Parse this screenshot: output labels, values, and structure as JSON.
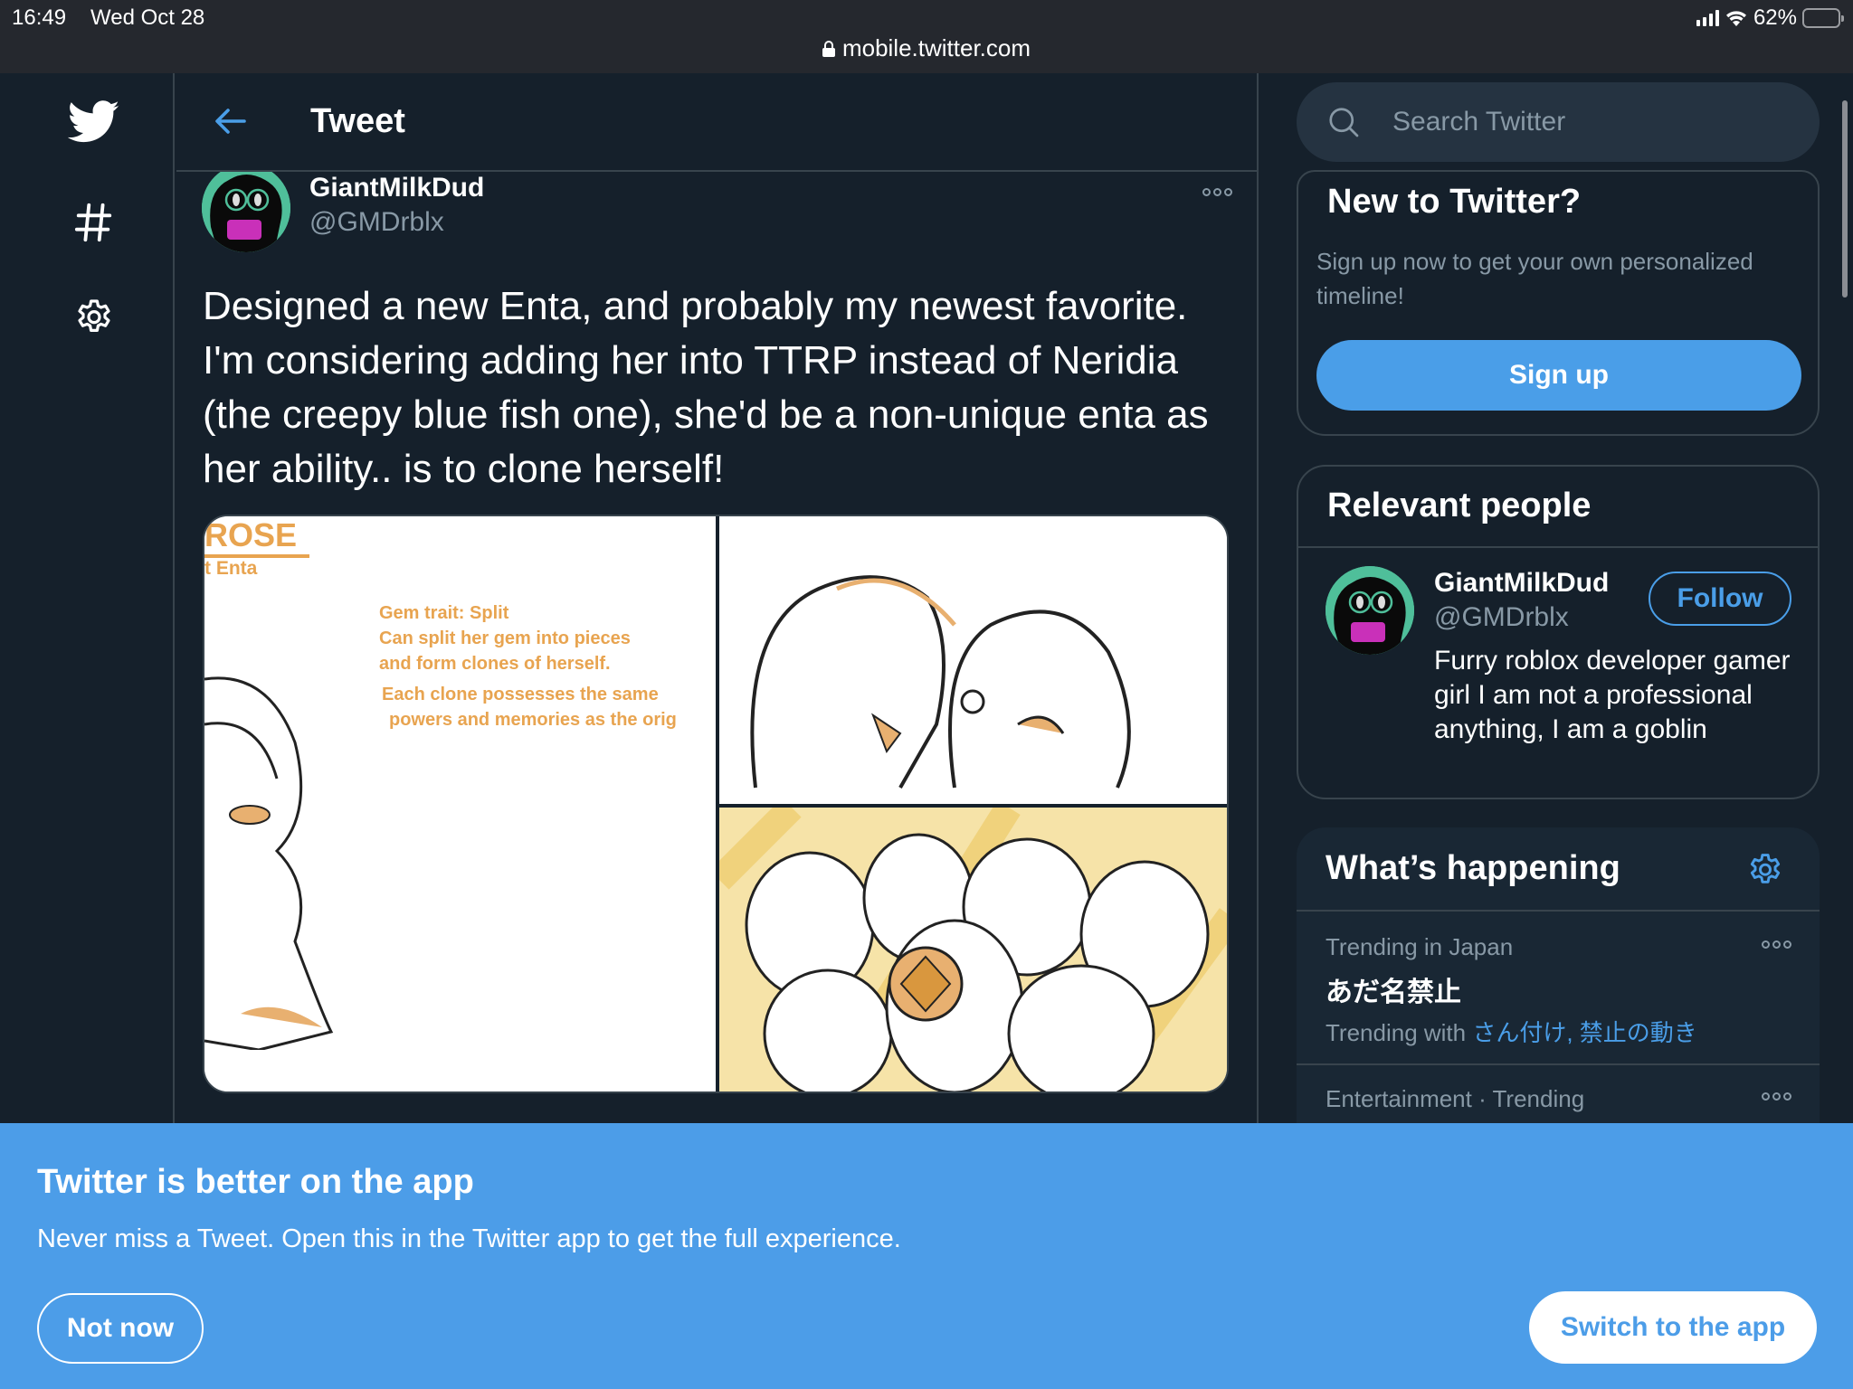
{
  "status_bar": {
    "time": "16:49",
    "date": "Wed Oct 28",
    "battery": "62%",
    "battery_level": 0.62,
    "url": "mobile.twitter.com"
  },
  "nav": {
    "items": [
      {
        "name": "twitter-logo",
        "icon": "twitter-bird-icon"
      },
      {
        "name": "explore",
        "icon": "hashtag-icon"
      },
      {
        "name": "settings",
        "icon": "gear-icon"
      }
    ]
  },
  "header": {
    "back_icon": "arrow-left-icon",
    "title": "Tweet"
  },
  "tweet": {
    "author_name": "GiantMilkDud",
    "author_handle": "@GMDrblx",
    "more_icon": "more-dots-icon",
    "text": "Designed a new Enta, and probably my newest favorite. I'm considering adding her into TTRP instead of Neridia (the creepy blue fish one), she'd be a non-unique enta as her ability.. is to clone herself!",
    "media": {
      "art_title": "ROSE",
      "art_subtitle": "t Enta",
      "art_lines": [
        "Gem trait: Split",
        "Can split her gem into pieces",
        "and form clones of herself.",
        "Each clone possesses the same",
        "powers and memories as the orig"
      ]
    }
  },
  "sidebar": {
    "search": {
      "placeholder": "Search Twitter",
      "value": ""
    },
    "new_to_twitter": {
      "title": "New to Twitter?",
      "description": "Sign up now to get your own personalized timeline!",
      "signup_label": "Sign up"
    },
    "relevant_people": {
      "title": "Relevant people",
      "people": [
        {
          "name": "GiantMilkDud",
          "handle": "@GMDrblx",
          "follow_label": "Follow",
          "bio": "Furry roblox developer gamer girl I am not a professional anything, I am a goblin"
        }
      ]
    },
    "whats_happening": {
      "title": "What’s happening",
      "trends": [
        {
          "meta": "Trending in Japan",
          "name": "あだ名禁止",
          "with_label": "Trending with",
          "with_links": "さん付け, 禁止の動き"
        },
        {
          "meta": "Entertainment · Trending"
        }
      ]
    }
  },
  "app_banner": {
    "title": "Twitter is better on the app",
    "description": "Never miss a Tweet. Open this in the Twitter app to get the full experience.",
    "not_now_label": "Not now",
    "switch_label": "Switch to the app"
  },
  "colors": {
    "background": "#15202b",
    "accent": "#4a9ee8",
    "secondary_text": "#8899a6",
    "border": "#38444d",
    "banner": "#4c9de8"
  }
}
